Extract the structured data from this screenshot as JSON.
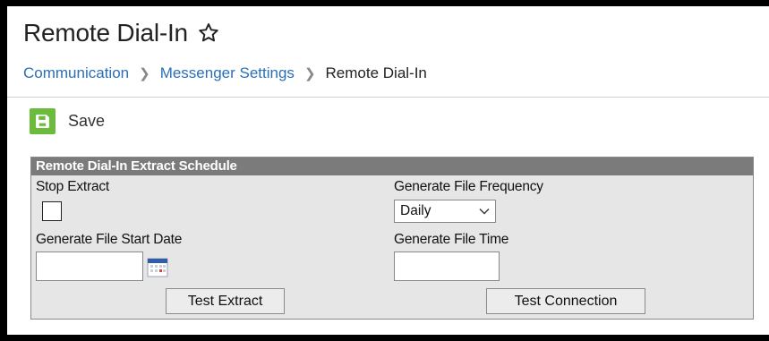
{
  "page": {
    "title": "Remote Dial-In"
  },
  "breadcrumb": [
    {
      "label": "Communication"
    },
    {
      "label": "Messenger Settings"
    },
    {
      "label": "Remote Dial-In"
    }
  ],
  "toolbar": {
    "save_label": "Save"
  },
  "panel": {
    "title": "Remote Dial-In Extract Schedule",
    "stop_extract": {
      "label": "Stop Extract",
      "checked": false
    },
    "frequency": {
      "label": "Generate File Frequency",
      "value": "Daily"
    },
    "start_date": {
      "label": "Generate File Start Date",
      "value": ""
    },
    "file_time": {
      "label": "Generate File Time",
      "value": ""
    },
    "test_extract_label": "Test Extract",
    "test_connection_label": "Test Connection"
  },
  "colors": {
    "save_green": "#6cbb3c",
    "link_blue": "#2a6fb7",
    "header_gray": "#7b7b7b",
    "panel_bg": "#e6e6e6"
  },
  "icons": [
    "star-icon",
    "save-icon",
    "chevron-down-icon",
    "calendar-icon",
    "chevron-right-icon"
  ]
}
